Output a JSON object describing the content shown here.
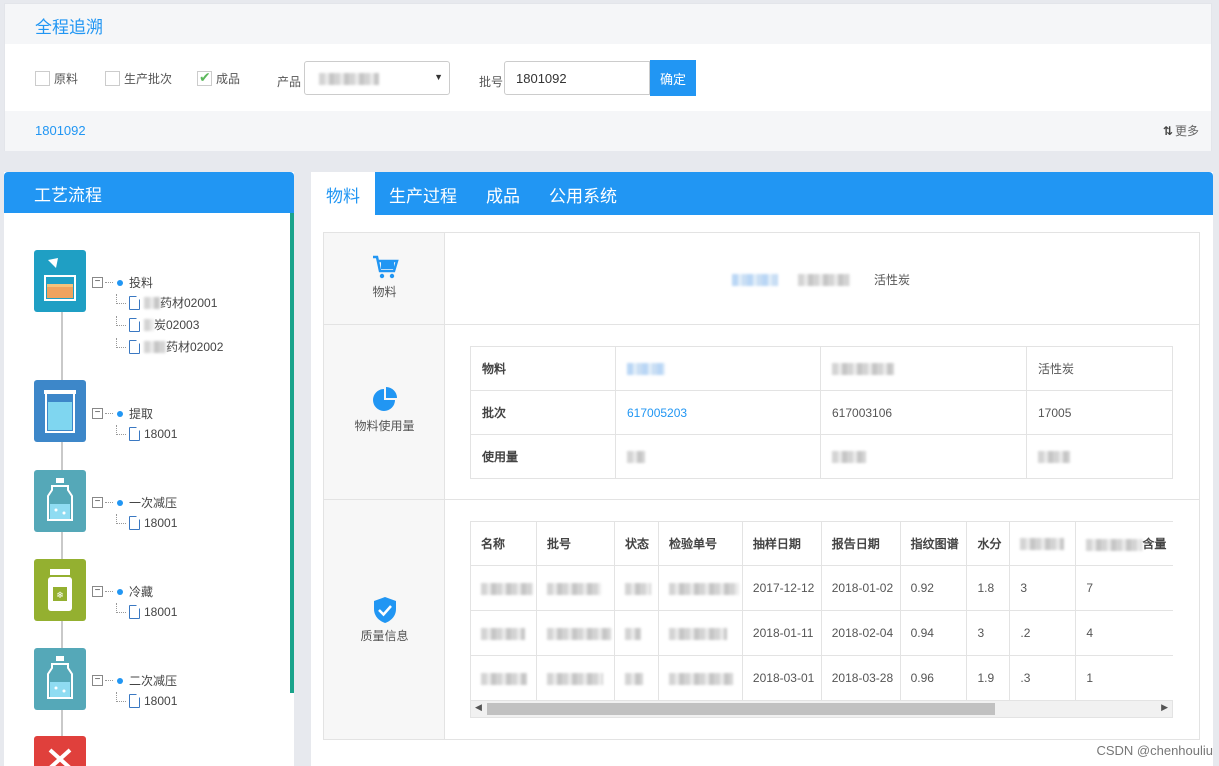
{
  "header": {
    "title": "全程追溯"
  },
  "filters": {
    "checkboxes": [
      {
        "label": "原料",
        "checked": false
      },
      {
        "label": "生产批次",
        "checked": false
      },
      {
        "label": "成品",
        "checked": true
      }
    ],
    "product_label": "产品",
    "batch_label": "批号",
    "batch_value": "1801092",
    "confirm_label": "确定"
  },
  "result": {
    "batch": "1801092",
    "more_label": "更多"
  },
  "process": {
    "title": "工艺流程",
    "steps": [
      {
        "name": "投料",
        "color": "#1f9fc4",
        "children": [
          "药材02001",
          "炭02003",
          "药材02002"
        ]
      },
      {
        "name": "提取",
        "color": "#3d87c9",
        "children": [
          "18001"
        ]
      },
      {
        "name": "一次减压",
        "color": "#55a8b8",
        "children": [
          "18001"
        ]
      },
      {
        "name": "冷藏",
        "color": "#94b030",
        "children": [
          "18001"
        ]
      },
      {
        "name": "二次减压",
        "color": "#55a8b8",
        "children": [
          "18001"
        ]
      }
    ]
  },
  "tabs": [
    "物料",
    "生产过程",
    "成品",
    "公用系统"
  ],
  "materials": {
    "section_label": "物料",
    "items_visible": [
      "活性炭"
    ]
  },
  "usage": {
    "section_label": "物料使用量",
    "rows": [
      {
        "head": "物料",
        "cells": [
          "",
          "",
          "活性炭"
        ]
      },
      {
        "head": "批次",
        "cells": [
          "617005203",
          "617003106",
          "17005"
        ]
      },
      {
        "head": "使用量",
        "cells": [
          "",
          "",
          ""
        ]
      }
    ]
  },
  "quality": {
    "section_label": "质量信息",
    "columns": [
      "名称",
      "批号",
      "状态",
      "检验单号",
      "抽样日期",
      "报告日期",
      "指纹图谱",
      "水分",
      "",
      "含量"
    ],
    "rows": [
      [
        "",
        "",
        "",
        "",
        "2017-12-12",
        "2018-01-02",
        "0.92",
        "1.8",
        "3",
        "7"
      ],
      [
        "",
        "",
        "",
        "",
        "2018-01-11",
        "2018-02-04",
        "0.94",
        "3",
        ".2",
        "4"
      ],
      [
        "",
        "",
        "",
        "",
        "2018-03-01",
        "2018-03-28",
        "0.96",
        "1.9",
        ".3",
        "1"
      ]
    ]
  },
  "watermark": "CSDN @chenhouliu"
}
